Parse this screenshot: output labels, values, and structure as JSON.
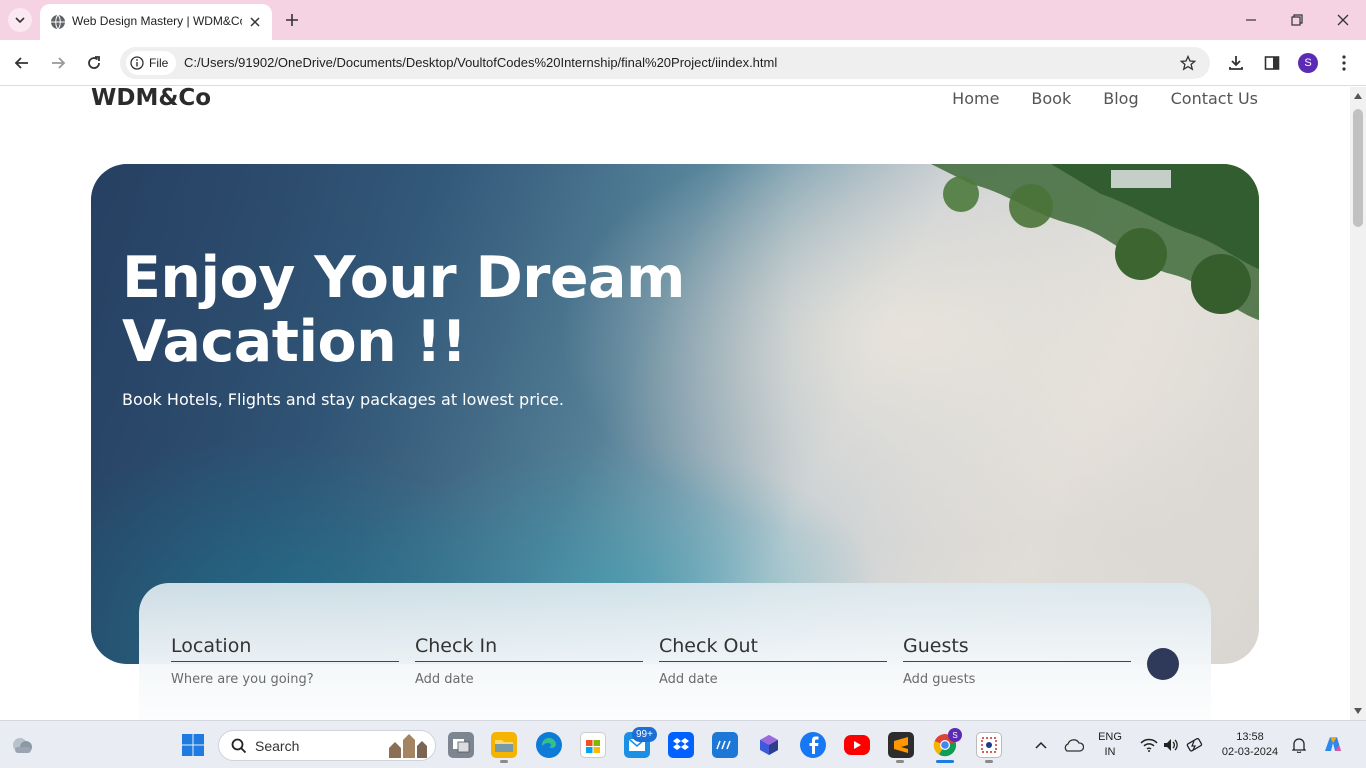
{
  "browser": {
    "tab_title": "Web Design Mastery | WDM&Co",
    "site_info_label": "File",
    "url": "C:/Users/91902/OneDrive/Documents/Desktop/VoultofCodes%20Internship/final%20Project/iindex.html",
    "profile_initial": "S"
  },
  "site": {
    "logo": "WDM&Co",
    "nav": [
      "Home",
      "Book",
      "Blog",
      "Contact Us"
    ]
  },
  "hero": {
    "title": "Enjoy Your Dream Vacation !!",
    "subtitle": "Book Hotels, Flights and stay packages at lowest price."
  },
  "booking": {
    "fields": [
      {
        "label": "Location",
        "placeholder": "Where are you going?"
      },
      {
        "label": "Check In",
        "placeholder": "Add date"
      },
      {
        "label": "Check Out",
        "placeholder": "Add date"
      },
      {
        "label": "Guests",
        "placeholder": "Add guests"
      }
    ]
  },
  "taskbar": {
    "search_label": "Search",
    "mail_badge": "99+",
    "language_top": "ENG",
    "language_bottom": "IN",
    "time": "13:58",
    "date": "02-03-2024",
    "chrome_profile_initial": "S"
  },
  "colors": {
    "tabstrip": "#f6d3e3",
    "search_button": "#2f3a5a",
    "field_underline": "#38446a"
  }
}
